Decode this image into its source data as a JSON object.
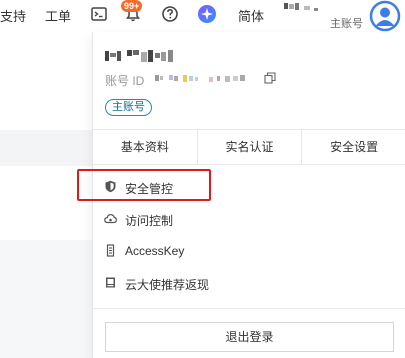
{
  "topbar": {
    "support_label": "支持",
    "ticket_label": "工单",
    "notification_badge": "99+",
    "language_label": "简体",
    "account_role": "主账号"
  },
  "panel": {
    "account_id_label": "账号 ID",
    "role_pill": "主账号",
    "tabs": [
      {
        "label": "基本资料"
      },
      {
        "label": "实名认证"
      },
      {
        "label": "安全设置"
      }
    ],
    "menu": [
      {
        "label": "安全管控",
        "icon": "shield-icon"
      },
      {
        "label": "访问控制",
        "icon": "cloud-icon"
      },
      {
        "label": "AccessKey",
        "icon": "key-icon"
      },
      {
        "label": "云大使推荐返现",
        "icon": "gift-icon"
      }
    ],
    "logout_label": "退出登录"
  },
  "colors": {
    "accent": "#1a8fb5",
    "highlight": "#e01a1a",
    "badge": "#f56b2a"
  }
}
